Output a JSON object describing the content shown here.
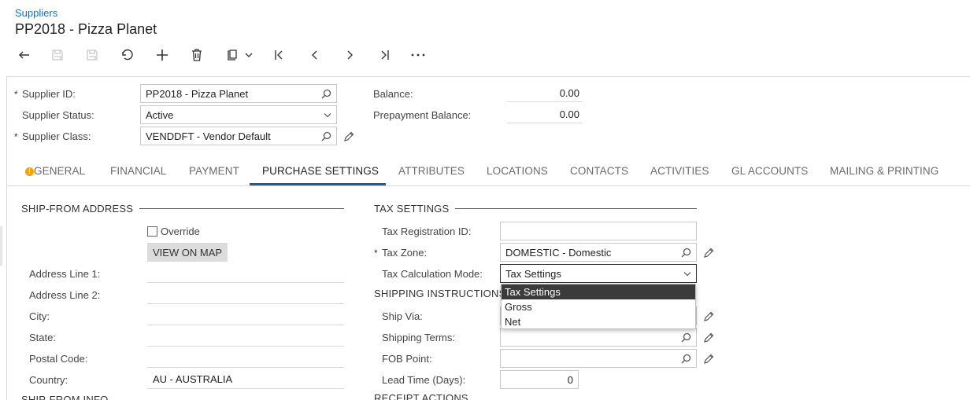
{
  "header": {
    "breadcrumb": "Suppliers",
    "title": "PP2018 - Pizza Planet"
  },
  "toolbar": {
    "icons": [
      "back-icon",
      "save-icon",
      "save-close-icon",
      "undo-icon",
      "add-icon",
      "delete-icon",
      "copy-paste-icon",
      "first-icon",
      "previous-icon",
      "next-icon",
      "last-icon",
      "more-icon"
    ]
  },
  "summary": {
    "supplier_id_label": "Supplier ID:",
    "supplier_id_value": "PP2018 - Pizza Planet",
    "supplier_status_label": "Supplier Status:",
    "supplier_status_value": "Active",
    "supplier_class_label": "Supplier Class:",
    "supplier_class_value": "VENDDFT - Vendor Default",
    "balance_label": "Balance:",
    "balance_value": "0.00",
    "prepayment_label": "Prepayment Balance:",
    "prepayment_value": "0.00",
    "required_mark": "*"
  },
  "tabs": [
    {
      "label": "GENERAL",
      "warning": "!"
    },
    {
      "label": "FINANCIAL"
    },
    {
      "label": "PAYMENT"
    },
    {
      "label": "PURCHASE SETTINGS",
      "active": true
    },
    {
      "label": "ATTRIBUTES"
    },
    {
      "label": "LOCATIONS"
    },
    {
      "label": "CONTACTS"
    },
    {
      "label": "ACTIVITIES"
    },
    {
      "label": "GL ACCOUNTS"
    },
    {
      "label": "MAILING & PRINTING"
    }
  ],
  "ship_from": {
    "section_title": "SHIP-FROM ADDRESS",
    "override_label": "Override",
    "view_map_label": "VIEW ON MAP",
    "address1_label": "Address Line 1:",
    "address2_label": "Address Line 2:",
    "city_label": "City:",
    "state_label": "State:",
    "postal_label": "Postal Code:",
    "country_label": "Country:",
    "country_value": "AU - AUSTRALIA",
    "next_section_title": "SHIP-FROM INFO"
  },
  "tax": {
    "section_title": "TAX SETTINGS",
    "registration_label": "Tax Registration ID:",
    "zone_label": "Tax Zone:",
    "zone_value": "DOMESTIC - Domestic",
    "calc_mode_label": "Tax Calculation Mode:",
    "calc_mode_value": "Tax Settings",
    "calc_mode_options": [
      "Tax Settings",
      "Gross",
      "Net"
    ]
  },
  "shipping": {
    "section_title": "SHIPPING INSTRUCTIONS",
    "ship_via_label": "Ship Via:",
    "terms_label": "Shipping Terms:",
    "fob_label": "FOB Point:",
    "lead_time_label": "Lead Time (Days):",
    "lead_time_value": "0",
    "next_section_title": "RECEIPT ACTIONS"
  },
  "colors": {
    "link": "#1a6eb7",
    "accent": "#1f5d99",
    "warning": "#f0a500",
    "selected_option_bg": "#3b3b3b"
  }
}
